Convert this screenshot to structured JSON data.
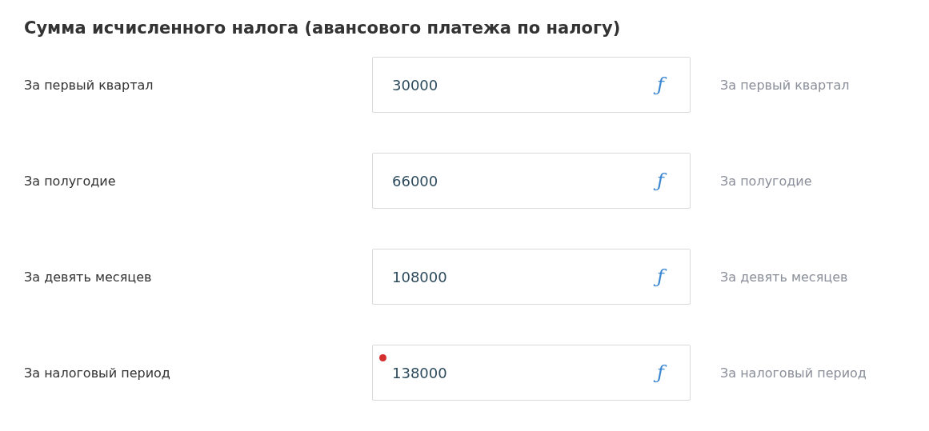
{
  "title": "Сумма исчисленного налога (авансового платежа по налогу)",
  "rows": [
    {
      "label": "За первый квартал",
      "value": "30000",
      "formula_mark": "ƒ",
      "hint": "За первый квартал",
      "flagged": false
    },
    {
      "label": "За полугодие",
      "value": "66000",
      "formula_mark": "ƒ",
      "hint": "За полугодие",
      "flagged": false
    },
    {
      "label": "За девять месяцев",
      "value": "108000",
      "formula_mark": "ƒ",
      "hint": "За девять месяцев",
      "flagged": false
    },
    {
      "label": "За налоговый период",
      "value": "138000",
      "formula_mark": "ƒ",
      "hint": "За налоговый период",
      "flagged": true
    }
  ]
}
